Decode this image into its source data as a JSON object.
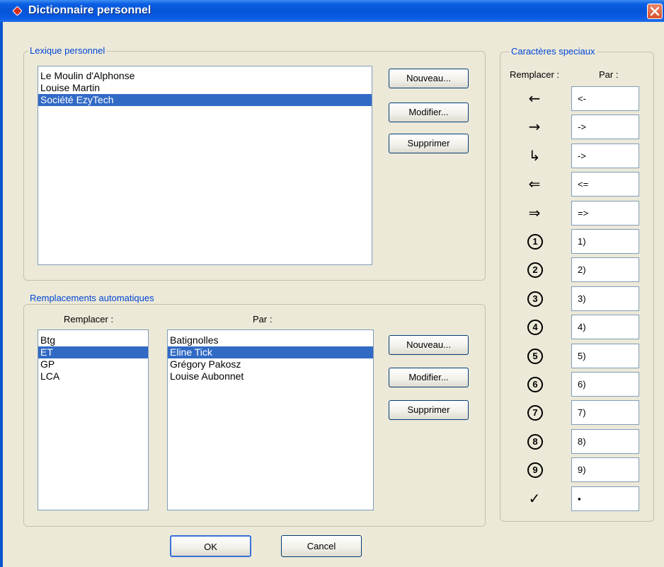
{
  "window": {
    "title": "Dictionnaire personnel"
  },
  "lexique": {
    "legend": "Lexique personnel",
    "items": [
      "Le Moulin d'Alphonse",
      "Louise Martin",
      "Société EzyTech"
    ],
    "selected": 2,
    "buttons": {
      "new": "Nouveau...",
      "edit": "Modifier...",
      "delete": "Supprimer"
    }
  },
  "remplacements": {
    "legend": "Remplacements automatiques",
    "replace_header": "Remplacer :",
    "by_header": "Par :",
    "replace_items": [
      "Btg",
      "ET",
      "GP",
      "LCA"
    ],
    "by_items": [
      "Batignolles",
      "Eline Tick",
      "Grégory Pakosz",
      "Louise Aubonnet"
    ],
    "selected": 1,
    "buttons": {
      "new": "Nouveau...",
      "edit": "Modifier...",
      "delete": "Supprimer"
    }
  },
  "speciaux": {
    "legend": "Caractères speciaux",
    "replace_header": "Remplacer :",
    "by_header": "Par :",
    "rows": [
      {
        "symbol": "←",
        "icon": "arrow-left-icon",
        "value": "<-"
      },
      {
        "symbol": "→",
        "icon": "arrow-right-icon",
        "value": "->"
      },
      {
        "symbol": "↳",
        "icon": "arrow-down-right-icon",
        "value": "->"
      },
      {
        "symbol": "⇐",
        "icon": "double-arrow-left-icon",
        "value": "<="
      },
      {
        "symbol": "⇒",
        "icon": "double-arrow-right-icon",
        "value": "=>"
      },
      {
        "symbol": "1",
        "icon": "circled-1-icon",
        "value": "1)"
      },
      {
        "symbol": "2",
        "icon": "circled-2-icon",
        "value": "2)"
      },
      {
        "symbol": "3",
        "icon": "circled-3-icon",
        "value": "3)"
      },
      {
        "symbol": "4",
        "icon": "circled-4-icon",
        "value": "4)"
      },
      {
        "symbol": "5",
        "icon": "circled-5-icon",
        "value": "5)"
      },
      {
        "symbol": "6",
        "icon": "circled-6-icon",
        "value": "6)"
      },
      {
        "symbol": "7",
        "icon": "circled-7-icon",
        "value": "7)"
      },
      {
        "symbol": "8",
        "icon": "circled-8-icon",
        "value": "8)"
      },
      {
        "symbol": "9",
        "icon": "circled-9-icon",
        "value": "9)"
      },
      {
        "symbol": "✓",
        "icon": "checkmark-icon",
        "value": "▪"
      }
    ]
  },
  "footer": {
    "ok": "OK",
    "cancel": "Cancel"
  },
  "colors": {
    "accent": "#0046d5",
    "selection": "#316ac5",
    "title_bar": "#0654d6"
  }
}
